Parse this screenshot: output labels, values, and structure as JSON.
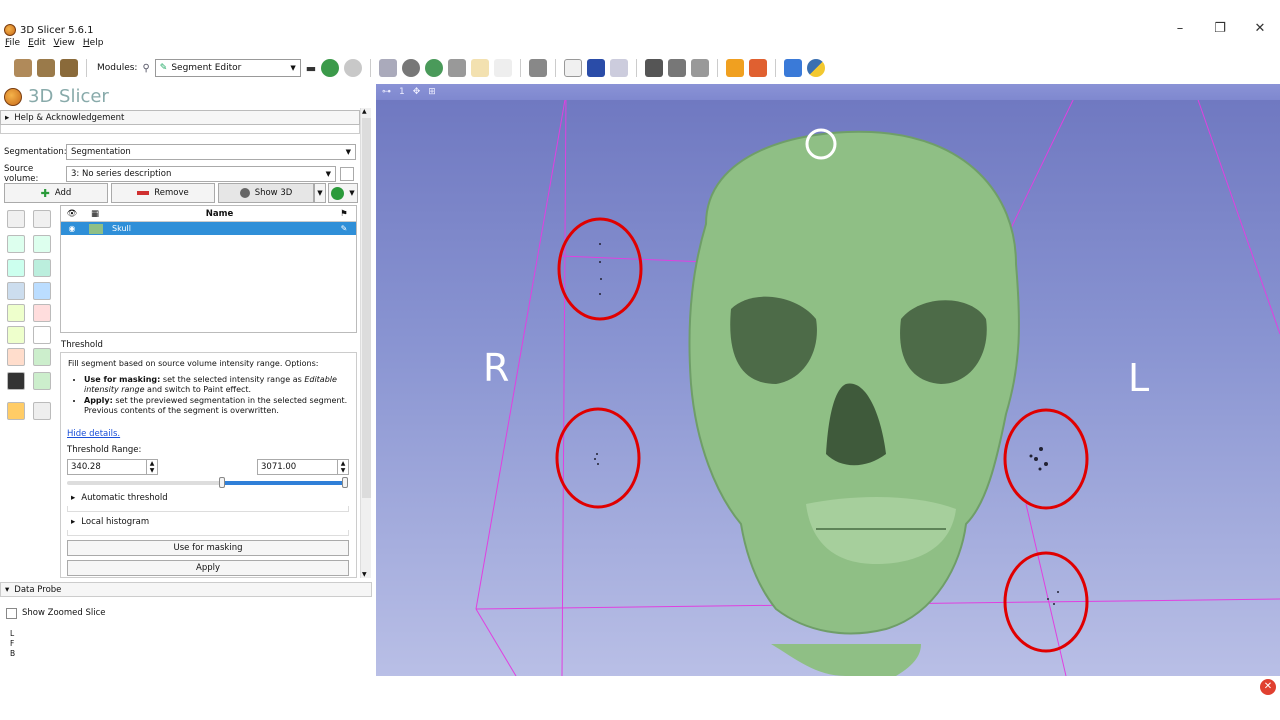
{
  "window": {
    "title": "3D Slicer 5.6.1",
    "minimize": "–",
    "restore": "❐",
    "close": "✕"
  },
  "menu": [
    "File",
    "Edit",
    "View",
    "Help"
  ],
  "toolbar": {
    "modules_label": "Modules:",
    "module_selected": "Segment Editor"
  },
  "app_logo_text": "3D Slicer",
  "help_section": "Help & Acknowledgement",
  "segmentation": {
    "label": "Segmentation:",
    "value": "Segmentation"
  },
  "source_volume": {
    "label": "Source volume:",
    "value": "3: No series description"
  },
  "buttons": {
    "add": "Add",
    "remove": "Remove",
    "show3d": "Show 3D"
  },
  "segment_table": {
    "name_header": "Name",
    "rows": [
      {
        "name": "Skull",
        "color": "#8fbf85"
      }
    ]
  },
  "effect": {
    "title": "Threshold",
    "description": "Fill segment based on source volume intensity range. Options:",
    "bullet1_bold": "Use for masking:",
    "bullet1_text": " set the selected intensity range as ",
    "bullet1_em": "Editable intensity range",
    "bullet1_tail": " and switch to Paint effect.",
    "bullet2_bold": "Apply:",
    "bullet2_text": " set the previewed segmentation in the selected segment. Previous contents of the segment is overwritten.",
    "hide_details": "Hide details.",
    "range_label": "Threshold Range:",
    "range_min": "340.28",
    "range_max": "3071.00",
    "auto_threshold": "Automatic threshold",
    "local_histogram": "Local histogram",
    "use_masking_btn": "Use for masking",
    "apply_btn": "Apply"
  },
  "data_probe": {
    "title": "Data Probe",
    "show_zoomed": "Show Zoomed Slice",
    "coords": [
      "L",
      "F",
      "B"
    ]
  },
  "view3d": {
    "view_number": "1",
    "labels": {
      "right": "R",
      "left": "L"
    },
    "background_top": "#6e77c0",
    "background_bottom": "#b9bfe6",
    "skull_color": "#8fbf85",
    "annotation_color": "#e00000"
  }
}
